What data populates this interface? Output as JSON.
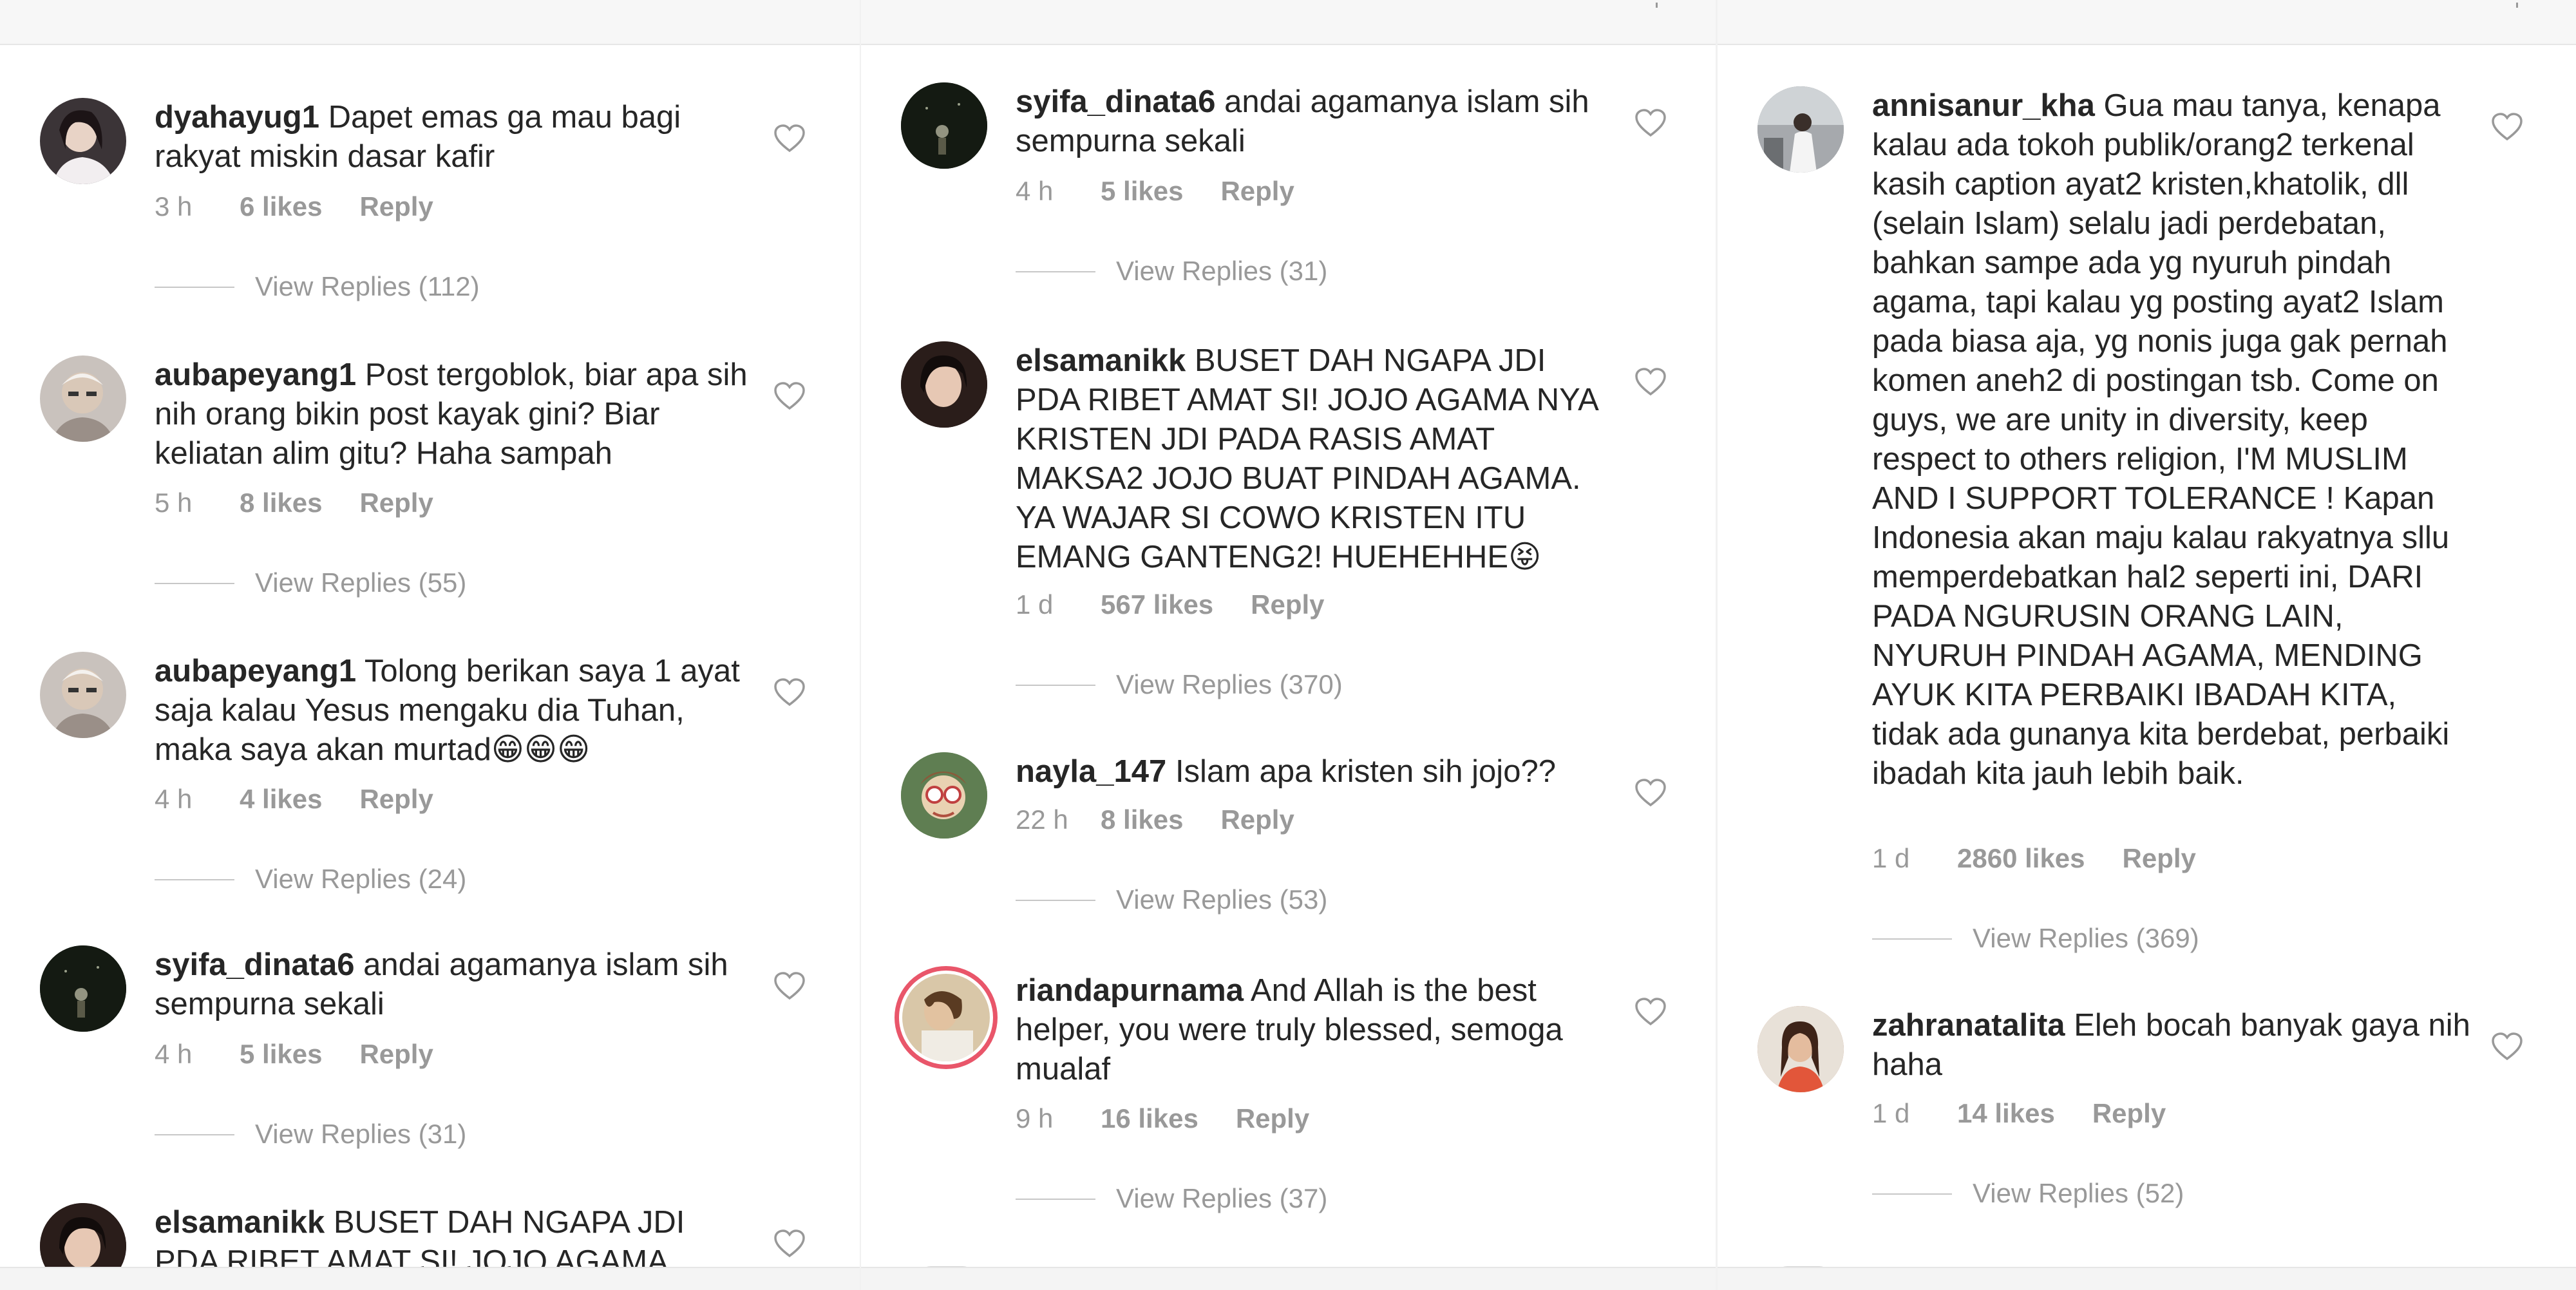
{
  "panels": [
    {
      "comments": [
        {
          "username": "dyahayug1",
          "text": "Dapet emas ga mau bagi rakyat miskin dasar kafir",
          "time": "3 h",
          "likes": "6 likes",
          "reply": "Reply",
          "replies": "View Replies (112)",
          "avatar_color": "#3b3437"
        },
        {
          "username": "aubapeyang1",
          "text": "Post tergoblok, biar apa sih nih orang bikin post kayak gini? Biar keliatan alim gitu? Haha sampah",
          "time": "5 h",
          "likes": "8 likes",
          "reply": "Reply",
          "replies": "View Replies (55)",
          "avatar_color": "#c9c2bd"
        },
        {
          "username": "aubapeyang1",
          "text": "Tolong berikan saya 1 ayat saja kalau Yesus mengaku dia Tuhan, maka saya akan murtad",
          "emoji": "😁😁😁",
          "time": "4 h",
          "likes": "4 likes",
          "reply": "Reply",
          "replies": "View Replies (24)",
          "avatar_color": "#c9c2bd"
        },
        {
          "username": "syifa_dinata6",
          "text": "andai agamanya islam sih sempurna sekali",
          "time": "4 h",
          "likes": "5 likes",
          "reply": "Reply",
          "replies": "View Replies (31)",
          "avatar_color": "#1a2216"
        },
        {
          "username": "elsamanikk",
          "text": "BUSET DAH NGAPA JDI PDA RIBET AMAT SI! JOJO AGAMA",
          "avatar_color": "#2a1d1a"
        }
      ]
    },
    {
      "comments": [
        {
          "username": "syifa_dinata6",
          "text": "andai agamanya islam sih sempurna sekali",
          "time": "4 h",
          "likes": "5 likes",
          "reply": "Reply",
          "replies": "View Replies (31)",
          "avatar_color": "#1a2216"
        },
        {
          "username": "elsamanikk",
          "text": "BUSET DAH NGAPA JDI PDA RIBET AMAT SI! JOJO AGAMA NYA KRISTEN JDI PADA RASIS AMAT MAKSA2 JOJO BUAT PINDAH AGAMA. YA WAJAR SI COWO KRISTEN ITU EMANG GANTENG2! HUEHEHHE",
          "emoji": "😝",
          "time": "1 d",
          "likes": "567 likes",
          "reply": "Reply",
          "replies": "View Replies (370)",
          "avatar_color": "#2a1d1a"
        },
        {
          "username": "nayla_147",
          "text": "Islam apa kristen sih jojo??",
          "time": "22 h",
          "likes": "8 likes",
          "reply": "Reply",
          "replies": "View Replies (53)",
          "avatar_color": "#6d8a5c"
        },
        {
          "username": "riandapurnama",
          "text": "And Allah is the best helper, you were truly blessed, semoga mualaf",
          "time": "9 h",
          "likes": "16 likes",
          "reply": "Reply",
          "replies": "View Replies (37)",
          "avatar_color": "#d9c7a8"
        }
      ]
    },
    {
      "comments": [
        {
          "username": "annisanur_kha",
          "text": "Gua mau tanya, kenapa kalau ada tokoh publik/orang2 terkenal kasih caption ayat2 kristen,khatolik, dll (selain Islam) selalu jadi perdebatan, bahkan sampe ada yg nyuruh pindah agama, tapi kalau yg posting ayat2 Islam pada biasa aja, yg nonis juga gak pernah komen aneh2 di postingan tsb. Come on guys, we are unity in diversity, keep respect to others religion, I'M MUSLIM AND I SUPPORT TOLERANCE ! Kapan Indonesia akan maju kalau rakyatnya sllu memperdebatkan hal2 seperti ini, DARI PADA NGURUSIN ORANG LAIN, NYURUH PINDAH AGAMA, MENDING AYUK KITA PERBAIKI IBADAH KITA, tidak ada gunanya kita berdebat, perbaiki ibadah kita jauh lebih baik.",
          "time": "1 d",
          "likes": "2860 likes",
          "reply": "Reply",
          "replies": "View Replies (369)",
          "avatar_color": "#8c8f93"
        },
        {
          "username": "zahranatalita",
          "text": "Eleh bocah banyak gaya nih haha",
          "time": "1 d",
          "likes": "14 likes",
          "reply": "Reply",
          "replies": "View Replies (52)",
          "avatar_color": "#b07a5e"
        }
      ]
    }
  ]
}
